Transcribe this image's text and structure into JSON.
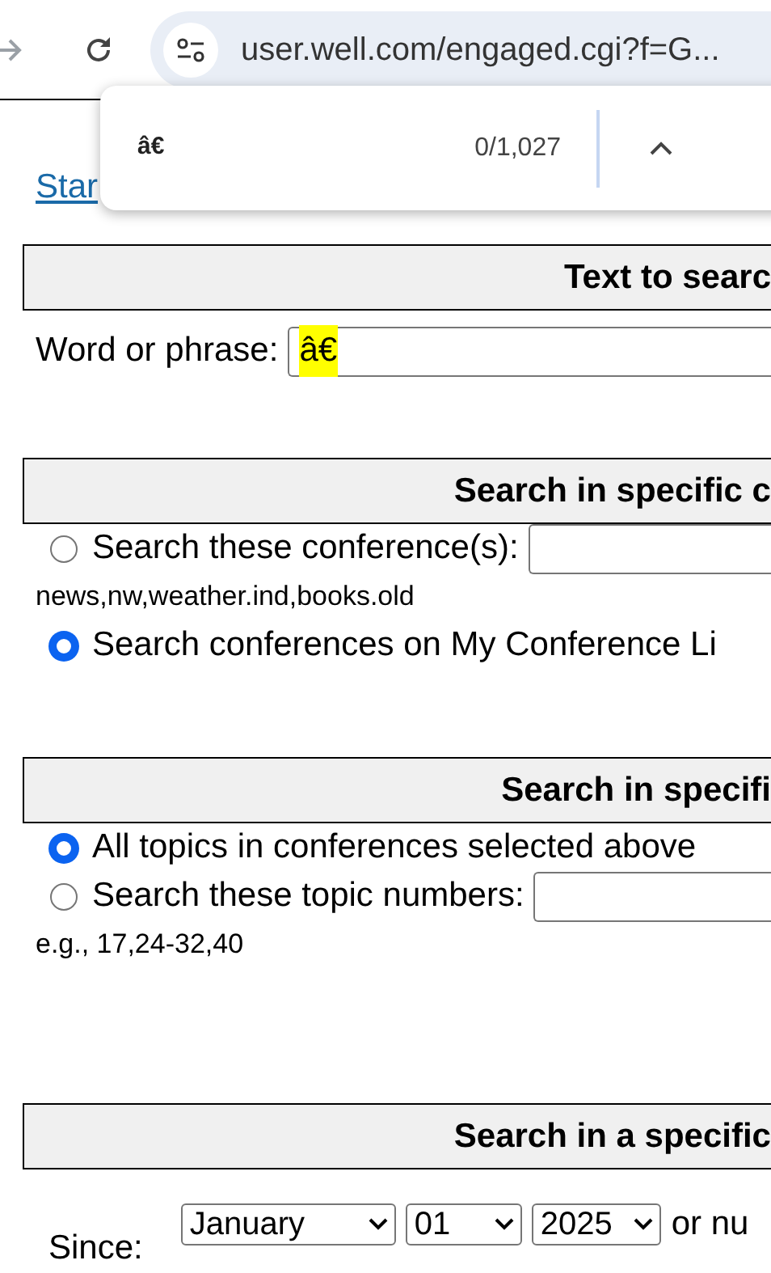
{
  "browser": {
    "url": "user.well.com/engaged.cgi?f=G..."
  },
  "find_bar": {
    "query": "â€",
    "count": "0/1,027"
  },
  "link": "Star",
  "sections": [
    {
      "heading": "Text to searc",
      "rows": [
        {
          "kind": "field",
          "label": "Word or phrase:",
          "value": "â€",
          "highlighted": true
        }
      ]
    },
    {
      "heading": "Search in specific c",
      "rows": [
        {
          "kind": "radio_field",
          "label": "Search these conference(s):",
          "selected": false
        },
        {
          "kind": "note",
          "text": "news,nw,weather.ind,books.old"
        },
        {
          "kind": "radio",
          "label": "Search conferences on My Conference Li",
          "selected": true
        }
      ]
    },
    {
      "heading": "Search in specifi",
      "rows": [
        {
          "kind": "radio",
          "label": "All topics in conferences selected above",
          "selected": true
        },
        {
          "kind": "radio_field",
          "label": "Search these topic numbers:",
          "selected": false
        },
        {
          "kind": "note",
          "text": "e.g., 17,24-32,40"
        }
      ]
    },
    {
      "heading": "Search in a specific",
      "rows": [
        {
          "kind": "date",
          "label": "Since:",
          "selects": [
            "January",
            "01",
            "2025"
          ],
          "trailing": "or nu"
        }
      ]
    }
  ]
}
